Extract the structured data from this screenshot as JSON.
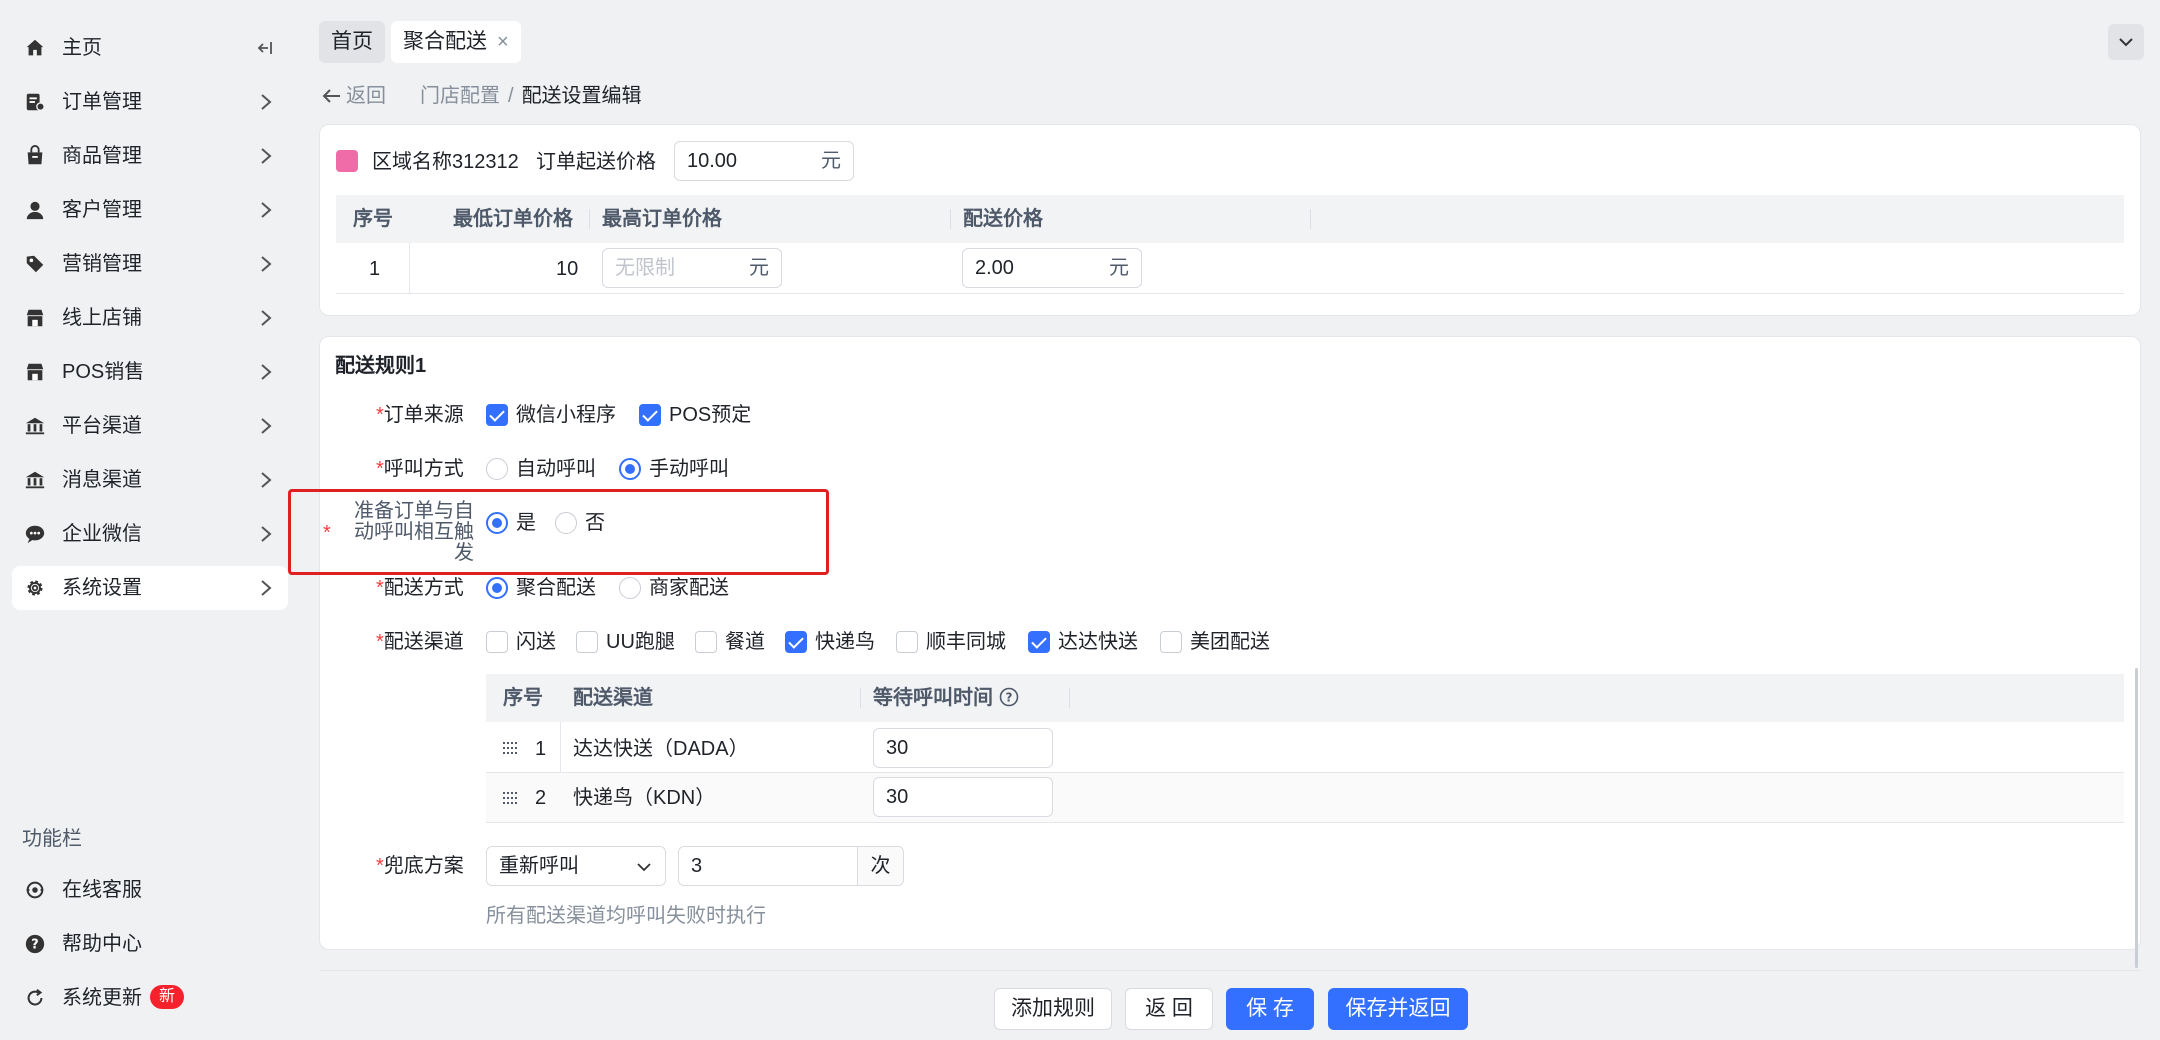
{
  "sidebar": {
    "items": [
      {
        "label": "主页",
        "icon": "home-icon"
      },
      {
        "label": "订单管理",
        "icon": "order-icon"
      },
      {
        "label": "商品管理",
        "icon": "goods-icon"
      },
      {
        "label": "客户管理",
        "icon": "customer-icon"
      },
      {
        "label": "营销管理",
        "icon": "tag-icon"
      },
      {
        "label": "线上店铺",
        "icon": "store-icon"
      },
      {
        "label": "POS销售",
        "icon": "pos-store-icon"
      },
      {
        "label": "平台渠道",
        "icon": "bank-icon"
      },
      {
        "label": "消息渠道",
        "icon": "message-bank-icon"
      },
      {
        "label": "企业微信",
        "icon": "wecom-icon"
      },
      {
        "label": "系统设置",
        "icon": "gear-icon"
      }
    ],
    "section_title": "功能栏",
    "tools": [
      {
        "label": "在线客服",
        "icon": "headset-icon"
      },
      {
        "label": "帮助中心",
        "icon": "help-icon"
      },
      {
        "label": "系统更新",
        "icon": "refresh-icon",
        "badge": "新"
      }
    ]
  },
  "tabs": [
    {
      "label": "首页",
      "active": false
    },
    {
      "label": "聚合配送",
      "active": true,
      "close": "×"
    }
  ],
  "breadcrumb": {
    "back": "返回",
    "path": [
      "门店配置",
      "配送设置编辑"
    ],
    "separator": "/"
  },
  "zone": {
    "name": "区域名称312312",
    "min_price_label": "订单起送价格",
    "min_price_value": "10.00",
    "unit": "元",
    "color": "#f06ca8",
    "table": {
      "headers": [
        "序号",
        "最低订单价格",
        "最高订单价格",
        "配送价格"
      ],
      "rows": [
        {
          "index": "1",
          "min": "10",
          "max_placeholder": "无限制",
          "max_unit": "元",
          "price": "2.00",
          "price_unit": "元"
        }
      ]
    }
  },
  "rule": {
    "title": "配送规则1",
    "required_mark": "*",
    "order_source": {
      "label": "订单来源",
      "options": [
        {
          "label": "微信小程序",
          "checked": true
        },
        {
          "label": "POS预定",
          "checked": true
        }
      ]
    },
    "call_mode": {
      "label": "呼叫方式",
      "options": [
        {
          "label": "自动呼叫",
          "checked": false
        },
        {
          "label": "手动呼叫",
          "checked": true
        }
      ]
    },
    "mutual_trigger": {
      "label_lines": [
        "准备订单与自",
        "动呼叫相互触",
        "发"
      ],
      "options": [
        {
          "label": "是",
          "checked": true
        },
        {
          "label": "否",
          "checked": false
        }
      ]
    },
    "delivery_mode": {
      "label": "配送方式",
      "options": [
        {
          "label": "聚合配送",
          "checked": true
        },
        {
          "label": "商家配送",
          "checked": false
        }
      ]
    },
    "channels": {
      "label": "配送渠道",
      "options": [
        {
          "label": "闪送",
          "checked": false
        },
        {
          "label": "UU跑腿",
          "checked": false
        },
        {
          "label": "餐道",
          "checked": false
        },
        {
          "label": "快递鸟",
          "checked": true
        },
        {
          "label": "顺丰同城",
          "checked": false
        },
        {
          "label": "达达快送",
          "checked": true
        },
        {
          "label": "美团配送",
          "checked": false
        }
      ]
    },
    "channel_table": {
      "headers": [
        "序号",
        "配送渠道",
        "等待呼叫时间"
      ],
      "help_icon": "question-circle-icon",
      "rows": [
        {
          "index": "1",
          "channel": "达达快送（DADA）",
          "wait": "30"
        },
        {
          "index": "2",
          "channel": "快递鸟（KDN）",
          "wait": "30"
        }
      ]
    },
    "fallback": {
      "label": "兜底方案",
      "select_value": "重新呼叫",
      "count_value": "3",
      "count_unit": "次",
      "hint": "所有配送渠道均呼叫失败时执行"
    }
  },
  "footer": {
    "add_rule": "添加规则",
    "back": "返 回",
    "save": "保 存",
    "save_back": "保存并返回"
  },
  "colors": {
    "primary": "#3370ff",
    "highlight": "#e02020",
    "badge": "#f5222d"
  }
}
